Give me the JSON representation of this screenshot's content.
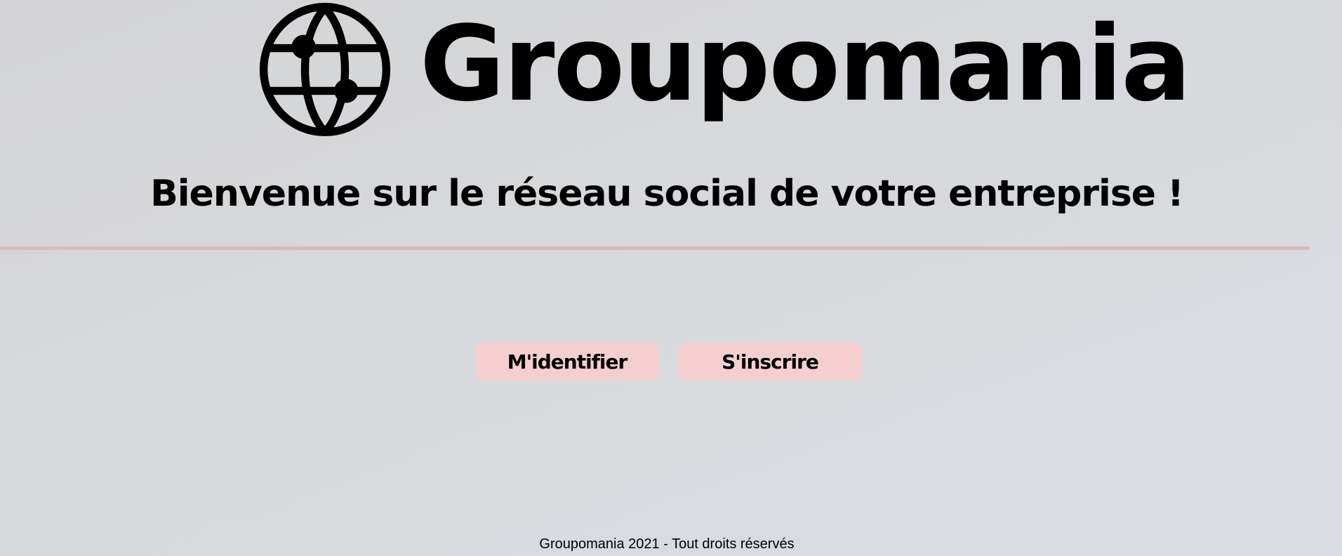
{
  "header": {
    "logo_text": "Groupomania",
    "logo_icon": "globe-icon",
    "welcome": "Bienvenue sur le réseau social de votre entreprise !"
  },
  "actions": {
    "login_label": "M'identifier",
    "signup_label": "S'inscrire"
  },
  "footer": {
    "text": "Groupomania 2021 - Tout droits réservés"
  },
  "colors": {
    "button_bg": "#f5cfd0",
    "divider": "#d9b9bb"
  }
}
